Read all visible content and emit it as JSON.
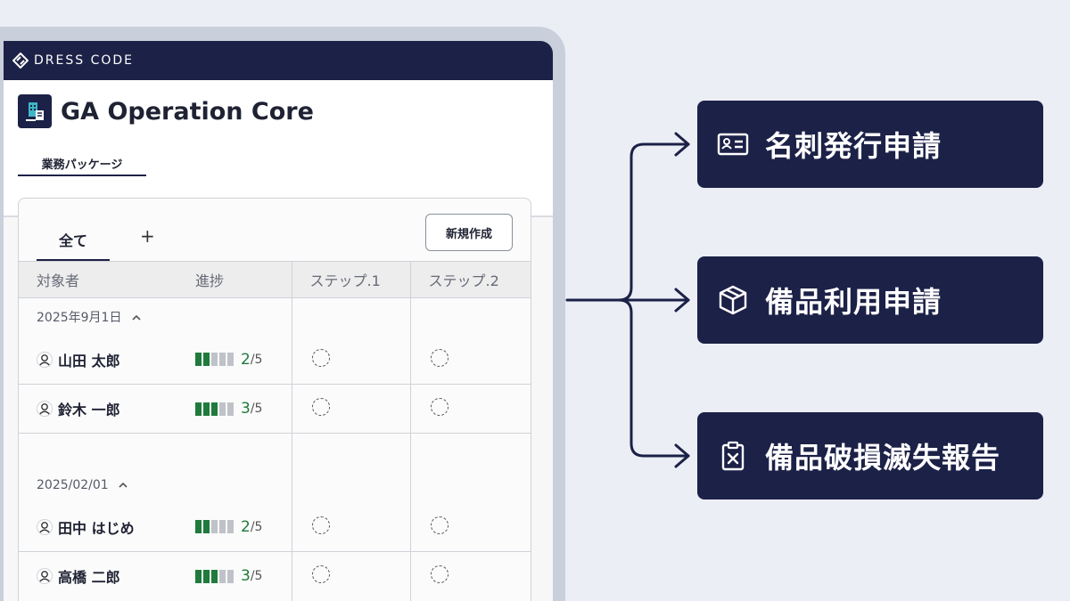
{
  "brand": {
    "name": "DRESS CODE"
  },
  "app": {
    "title": "GA Operation Core"
  },
  "tabs": {
    "package": "業務パッケージ"
  },
  "panel": {
    "tab_all": "全て",
    "tab_add": "+",
    "new_button": "新規作成",
    "columns": [
      "対象者",
      "進捗",
      "ステップ.1",
      "ステップ.2"
    ]
  },
  "groups": [
    {
      "date": "2025年9月1日",
      "rows": [
        {
          "name": "山田 太郎",
          "done": 2,
          "total": "/5"
        },
        {
          "name": "鈴木 一郎",
          "done": 3,
          "total": "/5"
        }
      ]
    },
    {
      "date": "2025/02/01",
      "rows": [
        {
          "name": "田中 はじめ",
          "done": 2,
          "total": "/5"
        },
        {
          "name": "高橋 二郎",
          "done": 3,
          "total": "/5"
        }
      ]
    }
  ],
  "cards": [
    {
      "label": "名刺発行申請",
      "icon": "id-card-icon"
    },
    {
      "label": "備品利用申請",
      "icon": "package-box-icon"
    },
    {
      "label": "備品破損滅失報告",
      "icon": "clipboard-x-icon"
    }
  ],
  "colors": {
    "navy": "#1c2147",
    "progress_green": "#1f7a3c",
    "background": "#eceef6"
  }
}
